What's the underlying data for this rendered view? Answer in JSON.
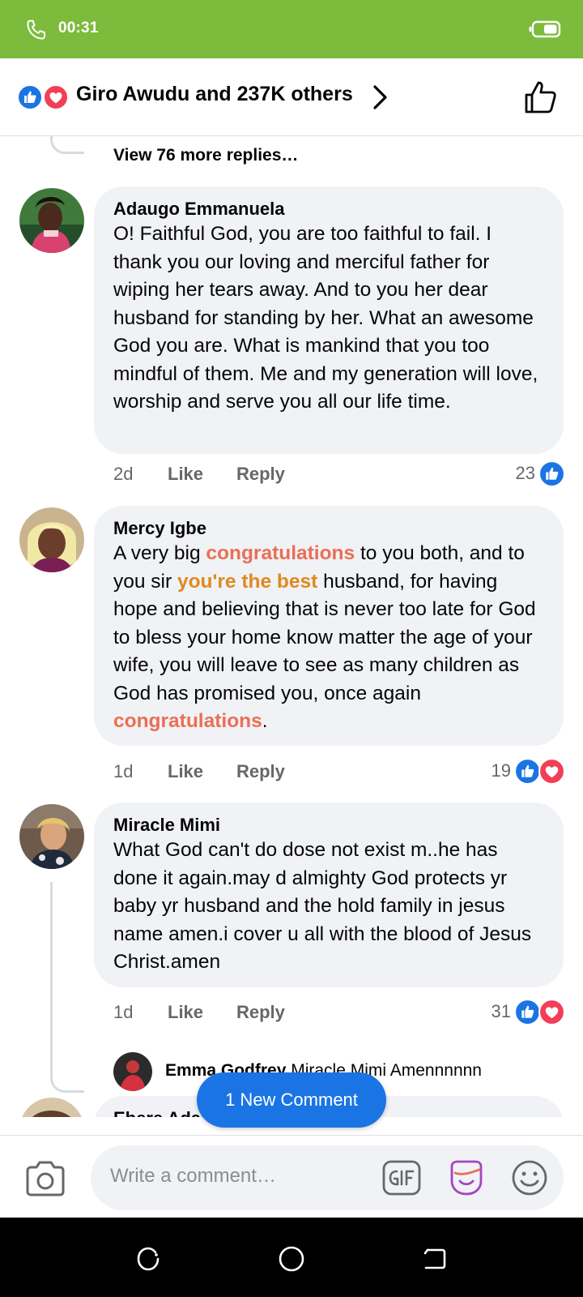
{
  "status_bar": {
    "time": "00:31"
  },
  "reactions_header": {
    "text": "Giro Awudu and 237K others"
  },
  "thread": {
    "view_more": "View 76 more replies…"
  },
  "comments": [
    {
      "author": "Adaugo Emmanuela",
      "body": "O! Faithful God, you are too faithful to fail. I thank you our loving and merciful father for wiping her tears away. And to you her dear husband for standing by her. What an awesome God you are. What is mankind that you too mindful of them. Me and my generation will love, worship and serve you all our life time.",
      "age": "2d",
      "like_label": "Like",
      "reply_label": "Reply",
      "reaction_count": "23"
    },
    {
      "author": "Mercy Igbe",
      "body_parts": [
        "A very big ",
        "congratulations",
        " to you both, and to you sir ",
        "you're the best",
        " husband, for having hope and believing that is never too late for God to bless your home know matter the age of your wife, you will leave to see as many children as God has promised you, once again ",
        "congratulations",
        "."
      ],
      "age": "1d",
      "like_label": "Like",
      "reply_label": "Reply",
      "reaction_count": "19"
    },
    {
      "author": "Miracle Mimi",
      "body": "What God can't do dose not exist m..he has done it again.may d almighty God protects yr baby yr husband and the hold family in jesus name amen.i cover u all with the blood of Jesus Christ.amen",
      "age": "1d",
      "like_label": "Like",
      "reply_label": "Reply",
      "reaction_count": "31",
      "reply": {
        "author": "Emma Godfrey",
        "text": " Miracle Mimi Amennnnnn"
      }
    },
    {
      "author": "Ebere Adazion"
    }
  ],
  "new_comment_button": "1 New Comment",
  "composer": {
    "placeholder": "Write a comment…"
  },
  "colors": {
    "status_bar": "#7dbb3c",
    "accent_blue": "#1b74e4",
    "love_red": "#f33e58",
    "highlight_coral": "#ea6f55",
    "highlight_orange": "#e0891d",
    "bubble_bg": "#f0f2f5"
  },
  "icons": [
    "call-icon",
    "battery-icon",
    "like-reaction-icon",
    "love-reaction-icon",
    "chevron-right-icon",
    "thumbs-up-icon",
    "camera-icon",
    "gif-icon",
    "sticker-icon",
    "emoji-icon",
    "recents-icon",
    "home-icon",
    "back-icon"
  ]
}
